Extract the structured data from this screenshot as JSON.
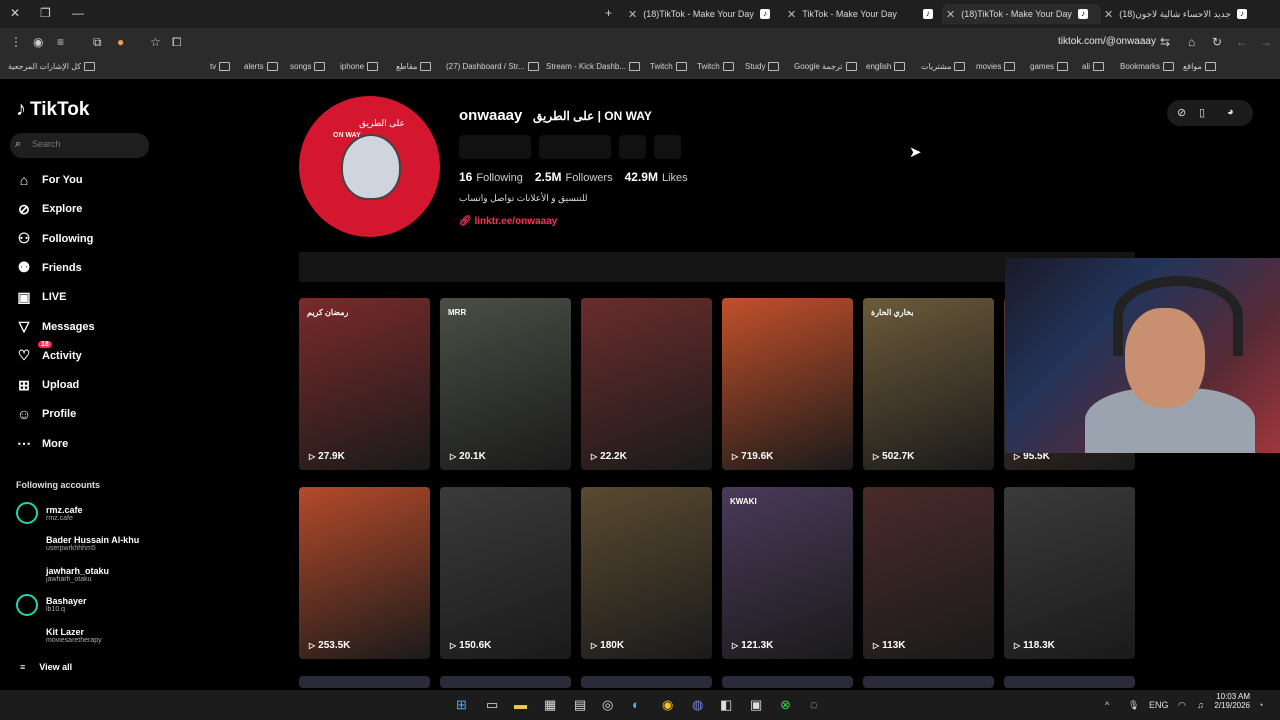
{
  "browser": {
    "tabs": [
      {
        "title": "(18)TikTok - Make Your Day",
        "active": false
      },
      {
        "title": "TikTok - Make Your Day",
        "active": false
      },
      {
        "title": "(18)TikTok - Make Your Day",
        "active": true
      },
      {
        "title": "(18)جديد الاحساء شالية لاجون",
        "active": false
      }
    ],
    "url": "tiktok.com/@onwaaay",
    "bookmarks": [
      "كل الإشارات المرجعية",
      "tv",
      "alerts",
      "songs",
      "iphone",
      "مقاطع",
      "(27) Dashboard / Str...",
      "Stream - Kick Dashb...",
      "Twitch",
      "Twitch",
      "Study",
      "Google ترجمة",
      "english",
      "مشتريات",
      "movies",
      "games",
      "ali",
      "Bookmarks",
      "مواقع"
    ]
  },
  "sidebar": {
    "logo": "TikTok",
    "search_placeholder": "Search",
    "nav": [
      {
        "label": "For You",
        "icon": "home-icon"
      },
      {
        "label": "Explore",
        "icon": "compass-icon"
      },
      {
        "label": "Following",
        "icon": "following-icon"
      },
      {
        "label": "Friends",
        "icon": "friends-icon"
      },
      {
        "label": "LIVE",
        "icon": "live-icon"
      },
      {
        "label": "Messages",
        "icon": "messages-icon"
      },
      {
        "label": "Activity",
        "icon": "activity-icon",
        "badge": "18"
      },
      {
        "label": "Upload",
        "icon": "upload-icon"
      },
      {
        "label": "Profile",
        "icon": "profile-icon"
      },
      {
        "label": "More",
        "icon": "more-icon"
      }
    ],
    "following_title": "Following accounts",
    "accounts": [
      {
        "name": "rmz.cafe",
        "handle": "rmz.cafe"
      },
      {
        "name": "Bader Hussain Al-khu",
        "handle": "userpwrkhhhm5"
      },
      {
        "name": "jawharh_otaku",
        "handle": "jawharh_otaku"
      },
      {
        "name": "Bashayer",
        "handle": "lb10.q"
      },
      {
        "name": "Kit Lazer",
        "handle": "moviesaretherapy"
      }
    ],
    "view_all": "View all"
  },
  "profile": {
    "username": "onwaaay",
    "display_name": "على الطريق | ON WAY",
    "avatar_text_ar": "على الطريق",
    "avatar_text_en": "ON WAY",
    "following": "16",
    "following_label": "Following",
    "followers": "2.5M",
    "followers_label": "Followers",
    "likes": "42.9M",
    "likes_label": "Likes",
    "bio": "للتنسيق و الأعلانات تواصل واتساب",
    "link": "linktr.ee/onwaaay"
  },
  "videos": [
    {
      "views": "27.9K",
      "color": "#7a2a2a",
      "label": "رمضان كريم"
    },
    {
      "views": "20.1K",
      "color": "#4a4f45",
      "label": "MRR"
    },
    {
      "views": "22.2K",
      "color": "#6a2c2c",
      "label": ""
    },
    {
      "views": "719.6K",
      "color": "#c2502a",
      "label": ""
    },
    {
      "views": "502.7K",
      "color": "#6c5a3a",
      "label": "بخاري الحارة"
    },
    {
      "views": "95.5K",
      "color": "#5a3a2a",
      "label": ""
    },
    {
      "views": "253.5K",
      "color": "#b44a2a",
      "label": ""
    },
    {
      "views": "150.6K",
      "color": "#3a3a3a",
      "label": ""
    },
    {
      "views": "180K",
      "color": "#5a4a30",
      "label": ""
    },
    {
      "views": "121.3K",
      "color": "#4a3a5a",
      "label": "KWAKI"
    },
    {
      "views": "113K",
      "color": "#4a2a2a",
      "label": ""
    },
    {
      "views": "118.3K",
      "color": "#3a3a3a",
      "label": ""
    }
  ],
  "taskbar": {
    "lang": "ENG",
    "time": "10:03 AM",
    "date": "2/19/2026"
  }
}
